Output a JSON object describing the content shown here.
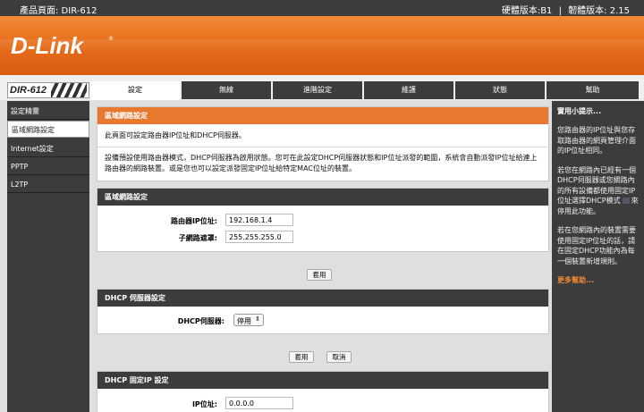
{
  "top": {
    "product": "產品頁面: DIR-612",
    "hw_label": "硬體版本:B1",
    "fw_label": "韌體版本: 2.15"
  },
  "brand": {
    "logo": "D-Link",
    "model": "DIR-612"
  },
  "tabs": [
    "設定",
    "無線",
    "進階設定",
    "維護",
    "狀態",
    "幫助"
  ],
  "sidebar": [
    "設定精靈",
    "區域網路設定",
    "Internet設定",
    "PPTP",
    "L2TP"
  ],
  "lan": {
    "title": "區域網路設定",
    "intro": "此頁面可設定路由器IP位址和DHCP伺服器。",
    "desc": "設備預設使用路由器模式，DHCP伺服器為啟用狀態。您可在此設定DHCP伺服器狀態和IP位址派發的範圍，系統會自動派發IP位址給連上路由器的網路裝置。或是您也可以設定派發固定IP位址給特定MAC位址的裝置。"
  },
  "lan_settings": {
    "title": "區域網路設定",
    "ip_label": "路由器IP位址:",
    "ip_value": "192.168.1.4",
    "mask_label": "子網路遮罩:",
    "mask_value": "255.255.255.0",
    "apply": "套用"
  },
  "dhcp": {
    "title": "DHCP 伺服器設定",
    "label": "DHCP伺服器:",
    "value": "停用",
    "apply": "套用",
    "cancel": "取消"
  },
  "static_ip": {
    "title": "DHCP 固定IP 設定",
    "ip_label": "IP位址:",
    "ip_value": "0.0.0.0"
  },
  "helper": {
    "title": "實用小提示...",
    "tip1": "您路由器的IP位址與您存取路由器的網頁管理介面的IP位址相同。",
    "tip2a": "若您在網路內已經有一個DHCP伺服器或您網路內的所有設備都使用固定IP位址選擇DHCP模式",
    "tip2b": "來停用此功能。",
    "tip3": "若在您網路內的裝置需要使用固定IP位址的話，請在固定DHCP功能內為每一個裝置新增規則。",
    "more": "更多幫助..."
  }
}
